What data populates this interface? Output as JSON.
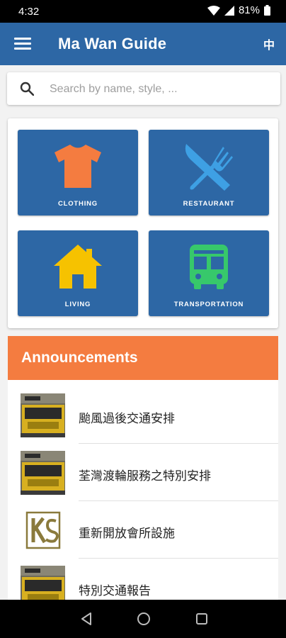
{
  "status_bar": {
    "time": "4:32",
    "battery": "81%"
  },
  "app_bar": {
    "title": "Ma Wan Guide",
    "lang_toggle": "中"
  },
  "search": {
    "placeholder": "Search by name, style, ..."
  },
  "categories": [
    {
      "label": "CLOTHING",
      "icon": "shirt-icon",
      "color": "#f47c40"
    },
    {
      "label": "RESTAURANT",
      "icon": "fork-knife-icon",
      "color": "#3ea0e4"
    },
    {
      "label": "LIVING",
      "icon": "house-icon",
      "color": "#f6c200"
    },
    {
      "label": "TRANSPORTATION",
      "icon": "bus-icon",
      "color": "#37c86b"
    }
  ],
  "announcements": {
    "title": "Announcements",
    "items": [
      {
        "text": "颱風過後交通安排",
        "thumb": "bus-photo"
      },
      {
        "text": "荃灣渡輪服務之特別安排",
        "thumb": "bus-photo"
      },
      {
        "text": "重新開放會所設施",
        "thumb": "ks-logo"
      },
      {
        "text": "特別交通報告",
        "thumb": "bus-photo"
      }
    ]
  },
  "colors": {
    "primary": "#2d67a5",
    "accent": "#f47c40"
  }
}
